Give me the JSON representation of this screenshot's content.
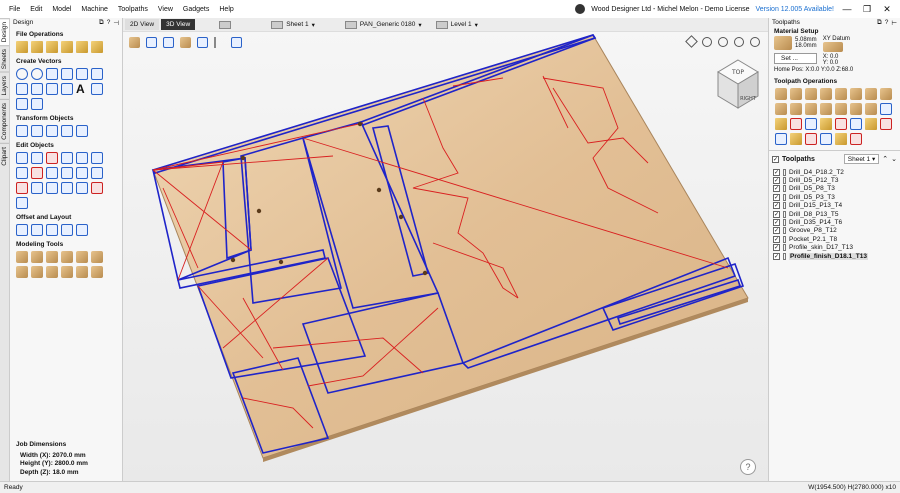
{
  "menu": [
    "File",
    "Edit",
    "Model",
    "Machine",
    "Toolpaths",
    "View",
    "Gadgets",
    "Help"
  ],
  "license_text": "Wood Designer Ltd - Michel Melon - Demo License",
  "version_text": "Version 12.005 Available!",
  "window_controls": [
    "—",
    "❐",
    "✕"
  ],
  "left_tabs": [
    "Design",
    "Sheets",
    "Layers",
    "Components",
    "Clipart"
  ],
  "design_panel": {
    "title": "Design",
    "sections": [
      {
        "title": "File Operations",
        "icons": [
          "new-file-icon",
          "open-file-icon",
          "import-icon",
          "save-icon",
          "import-model-icon",
          "export-icon"
        ]
      },
      {
        "title": "Create Vectors",
        "icons": [
          "circle-icon",
          "ellipse-icon",
          "rectangle-icon",
          "polygon-icon",
          "star-icon",
          "line-icon",
          "arc-icon",
          "curve-icon",
          "spiral-icon",
          "dimension-icon",
          "text-icon",
          "text-on-curve-icon",
          "text-arc-icon",
          "image-icon"
        ]
      },
      {
        "title": "Transform Objects",
        "icons": [
          "move-icon",
          "align-icon",
          "scale-icon",
          "rotate-icon",
          "mirror-icon"
        ]
      },
      {
        "title": "Edit Objects",
        "icons": [
          "select-icon",
          "node-edit-icon",
          "polygon-select-icon",
          "transform-icon",
          "group-icon",
          "measure-icon",
          "trim-icon",
          "weld-icon",
          "subtract-icon",
          "intersect-icon",
          "fillet-icon",
          "extend-icon",
          "join-icon",
          "close-icon-tool",
          "smooth-icon",
          "split-icon",
          "offset-node-icon",
          "array-icon",
          "distort-icon"
        ]
      },
      {
        "title": "Offset and Layout",
        "icons": [
          "offset-icon",
          "nest-icon",
          "array-copy-icon",
          "step-repeat-icon",
          "fit-icon"
        ]
      },
      {
        "title": "Modeling Tools",
        "icons": [
          "model-1-icon",
          "model-2-icon",
          "model-3-icon",
          "model-4-icon",
          "model-5-icon",
          "model-6-icon",
          "model-7-icon",
          "model-8-icon",
          "model-9-icon",
          "model-10-icon",
          "model-11-icon",
          "model-12-icon"
        ]
      }
    ]
  },
  "job_dimensions": {
    "title": "Job Dimensions",
    "width": "Width  (X): 2070.0 mm",
    "height": "Height (Y): 2800.0 mm",
    "depth": "Depth  (Z): 18.0 mm"
  },
  "view": {
    "tab_2d": "2D View",
    "tab_3d": "3D View",
    "sheet": "Sheet 1",
    "material": "PAN_Generic 0180",
    "level": "Level 1"
  },
  "toolpaths_panel": {
    "title": "Toolpaths",
    "material_setup": "Material Setup",
    "thickness": "5.08mm",
    "depth": "18.0mm",
    "datum": "XY Datum",
    "set_label": "Set ...",
    "x_val": "X: 0.0",
    "y_val": "Y: 0.0",
    "home_pos": "Home Pos:  X:0.0 Y:0.0 Z:68.0",
    "operations_title": "Toolpath Operations",
    "list_header": "Toolpaths",
    "sheet": "Sheet 1",
    "items": [
      {
        "label": "Drill_D4_P18.2_T2",
        "checked": true,
        "selected": false
      },
      {
        "label": "Drill_D5_P12_T3",
        "checked": true,
        "selected": false
      },
      {
        "label": "Drill_D5_P8_T3",
        "checked": true,
        "selected": false
      },
      {
        "label": "Drill_D5_P3_T3",
        "checked": true,
        "selected": false
      },
      {
        "label": "Drill_D15_P13_T4",
        "checked": true,
        "selected": false
      },
      {
        "label": "Drill_D8_P13_T5",
        "checked": true,
        "selected": false
      },
      {
        "label": "Drill_D35_P14_T6",
        "checked": true,
        "selected": false
      },
      {
        "label": "Groove_P8_T12",
        "checked": true,
        "selected": false
      },
      {
        "label": "Pocket_P2.1_T8",
        "checked": true,
        "selected": false
      },
      {
        "label": "Profile_skin_D17_T13",
        "checked": true,
        "selected": false
      },
      {
        "label": "Profile_finish_D18.1_T13",
        "checked": true,
        "selected": true
      }
    ]
  },
  "viewcube": {
    "top": "TOP",
    "right": "RIGHT"
  },
  "help_glyph": "?",
  "status": {
    "left": "Ready",
    "right": "W(1954.500) H(2780.000) x10"
  },
  "colors": {
    "sheet": "#e6c8a4",
    "vector": "#1f24c9",
    "toolpath": "#d92020",
    "accent": "#2a62c9"
  }
}
